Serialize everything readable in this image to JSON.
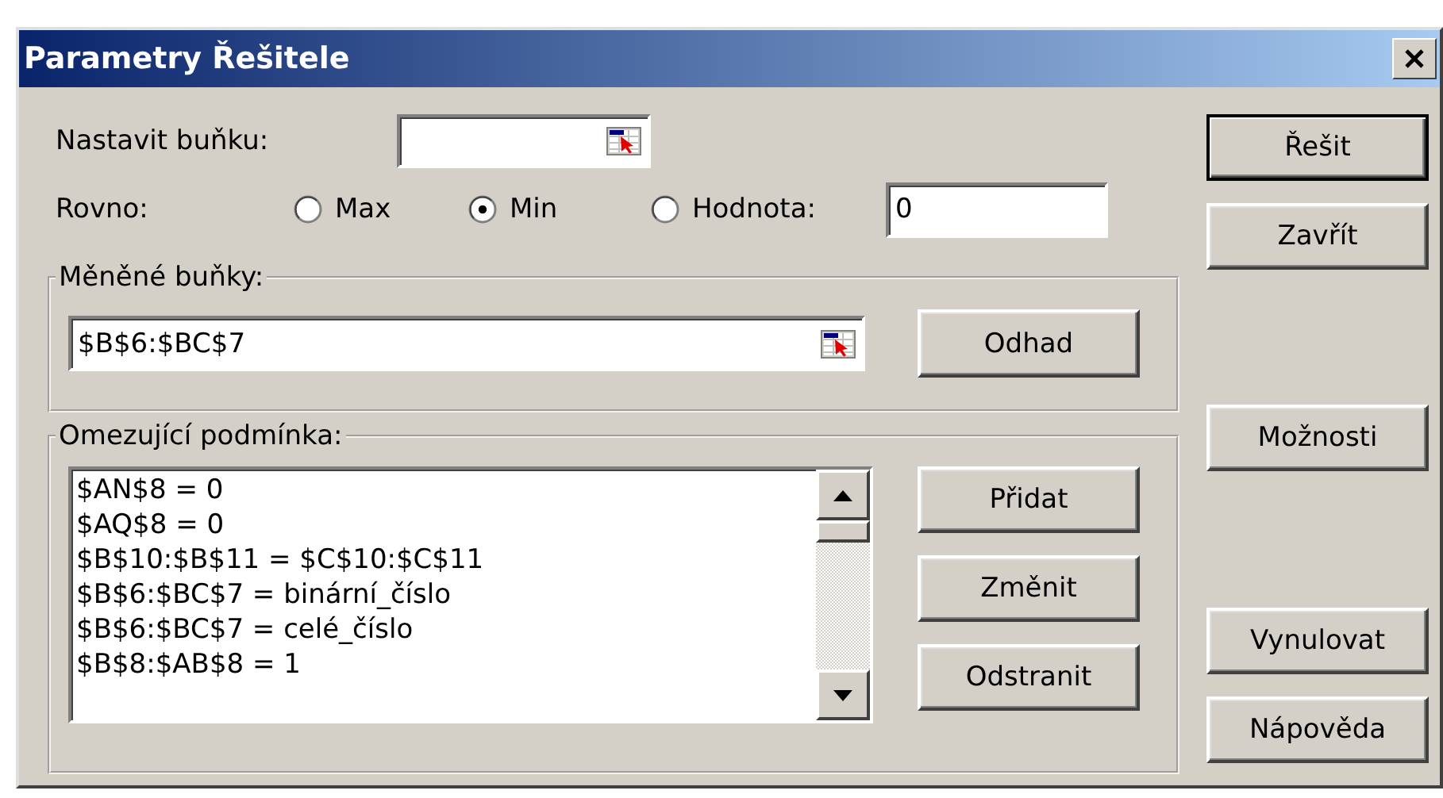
{
  "window": {
    "title": "Parametry Řešitele"
  },
  "target_cell": {
    "label": "Nastavit buňku:"
  },
  "equal_to": {
    "label": "Rovno:",
    "options": [
      {
        "label": "Max",
        "selected": false
      },
      {
        "label": "Min",
        "selected": true
      },
      {
        "label": "Hodnota:",
        "selected": false
      }
    ],
    "value": "0"
  },
  "changing_cells": {
    "title": "Měněné buňky:",
    "value": "$B$6:$BC$7",
    "button": "Odhad"
  },
  "constraints": {
    "title": "Omezující podmínka:",
    "items": [
      "$AN$8 = 0",
      "$AQ$8 = 0",
      "$B$10:$B$11 = $C$10:$C$11",
      "$B$6:$BC$7 = binární_číslo",
      "$B$6:$BC$7 = celé_číslo",
      "$B$8:$AB$8 = 1"
    ],
    "buttons": [
      "Přidat",
      "Změnit",
      "Odstranit"
    ]
  },
  "buttons": [
    {
      "label": "Řešit",
      "default": true
    },
    {
      "label": "Zavřít",
      "default": false
    },
    {
      "label": "Možnosti",
      "default": false
    },
    {
      "label": "Vynulovat",
      "default": false
    },
    {
      "label": "Nápověda",
      "default": false
    }
  ]
}
